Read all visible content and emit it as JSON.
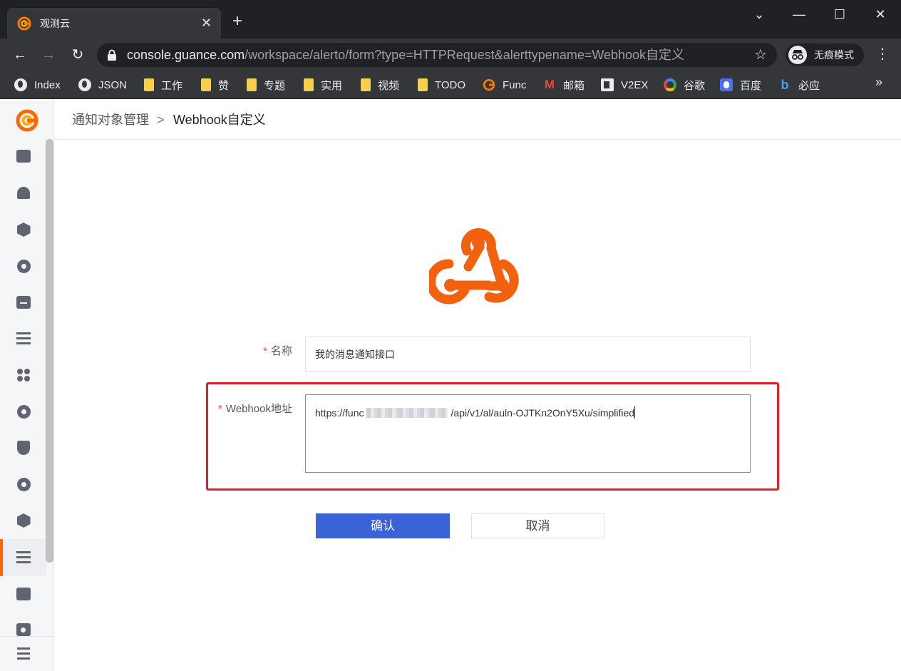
{
  "browser": {
    "tab": {
      "title": "观测云",
      "close_icon": "close-icon"
    },
    "new_tab_icon": "plus-icon",
    "window_controls": {
      "minimize": "chevron-down-icon",
      "restore": "minimize-icon",
      "maximize": "maximize-icon",
      "close": "close-icon"
    },
    "nav": {
      "back": "←",
      "forward": "→",
      "reload": "↻"
    },
    "address": {
      "host": "console.guance.com",
      "path": "/workspace/alerto/form?type=HTTPRequest&alerttypename=Webhook自定义"
    },
    "incognito_label": "无痕模式",
    "bookmarks": [
      {
        "label": "Index",
        "icon": "globe-icon"
      },
      {
        "label": "JSON",
        "icon": "globe-icon"
      },
      {
        "label": "工作",
        "icon": "folder-icon"
      },
      {
        "label": "赞",
        "icon": "folder-icon"
      },
      {
        "label": "专题",
        "icon": "folder-icon"
      },
      {
        "label": "实用",
        "icon": "folder-icon"
      },
      {
        "label": "视频",
        "icon": "folder-icon"
      },
      {
        "label": "TODO",
        "icon": "folder-icon"
      },
      {
        "label": "Func",
        "icon": "guance-logo-icon"
      },
      {
        "label": "邮箱",
        "icon": "mail-icon"
      },
      {
        "label": "V2EX",
        "icon": "v2ex-icon"
      },
      {
        "label": "谷歌",
        "icon": "google-icon"
      },
      {
        "label": "百度",
        "icon": "baidu-icon"
      },
      {
        "label": "必应",
        "icon": "bing-icon"
      }
    ],
    "bookmarks_more": "»"
  },
  "sidebar": {
    "icons": [
      "dashboard-icon",
      "bell-icon",
      "components-icon",
      "check-circle-icon",
      "calendar-list-icon",
      "filter-icon",
      "apps-icon",
      "satellite-icon",
      "shield-icon",
      "signal-icon",
      "cube-icon",
      "settings-sliders-icon",
      "billing-icon",
      "camera-icon"
    ],
    "active_icon": "settings-sliders-icon",
    "collapse_icon": "collapse-menu-icon"
  },
  "breadcrumb": {
    "parent": "通知对象管理",
    "separator": ">",
    "current": "Webhook自定义"
  },
  "form": {
    "name_label": "名称",
    "name_value": "我的消息通知接口",
    "webhook_label": "Webhook地址",
    "webhook_value_prefix": "https://func",
    "webhook_value_suffix": "/api/v1/al/auln-OJTKn2OnY5Xu/simplified",
    "required_mark": "*"
  },
  "actions": {
    "confirm": "确认",
    "cancel": "取消"
  },
  "colors": {
    "brand_orange": "#ff6600",
    "webhook_orange": "#f2610d",
    "primary_button": "#3b63d6",
    "highlight_red": "#e21d2c"
  }
}
